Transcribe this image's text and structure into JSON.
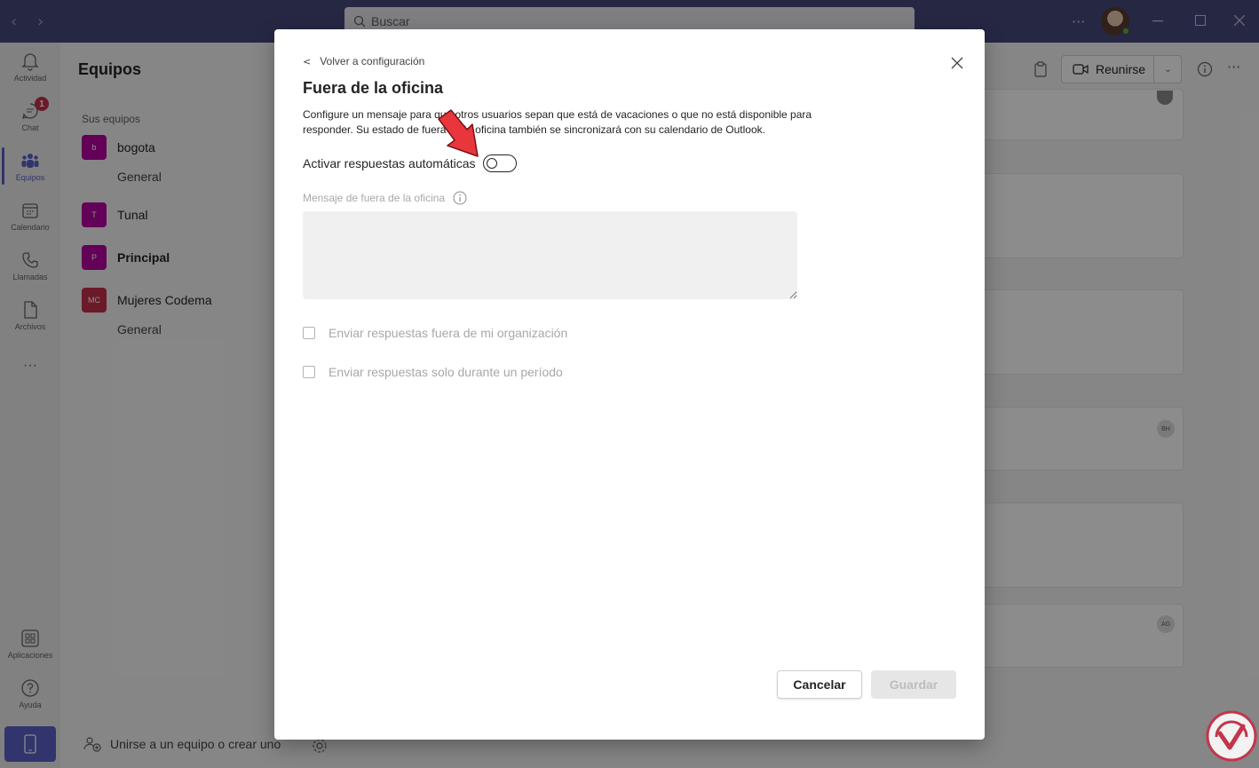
{
  "titlebar": {
    "search_placeholder": "Buscar",
    "back_icon": "chevron-left-icon",
    "forward_icon": "chevron-right-icon",
    "more_icon": "ellipsis-icon"
  },
  "rail": {
    "items": [
      {
        "label": "Actividad",
        "icon": "bell-icon"
      },
      {
        "label": "Chat",
        "icon": "chat-icon",
        "badge": "1"
      },
      {
        "label": "Equipos",
        "icon": "teams-icon",
        "active": true
      },
      {
        "label": "Calendario",
        "icon": "calendar-icon"
      },
      {
        "label": "Llamadas",
        "icon": "phone-icon"
      },
      {
        "label": "Archivos",
        "icon": "file-icon"
      },
      {
        "label": "Aplicaciones",
        "icon": "apps-icon"
      },
      {
        "label": "Ayuda",
        "icon": "help-icon"
      }
    ],
    "more_label": "···"
  },
  "panel": {
    "title": "Equipos",
    "subtitle": "Sus equipos",
    "teams": [
      {
        "name": "bogota",
        "initials": "b",
        "color": "#b4009e",
        "channel": "General"
      },
      {
        "name": "Tunal",
        "initials": "T",
        "color": "#b4009e"
      },
      {
        "name": "Principal",
        "initials": "P",
        "color": "#b4009e",
        "bold": true
      },
      {
        "name": "Mujeres Codema",
        "initials": "MC",
        "color": "#c4314b",
        "channel": "General"
      }
    ],
    "join_label": "Unirse a un equipo o crear uno"
  },
  "content": {
    "meet_label": "Reunirse",
    "avatars": [
      "BH",
      "AG"
    ]
  },
  "dialog": {
    "back_label": "Volver a configuración",
    "title": "Fuera de la oficina",
    "description": "Configure un mensaje para que otros usuarios sepan que está de vacaciones o que no está disponible para responder. Su estado de fuera de la oficina también se sincronizará con su calendario de Outlook.",
    "toggle_label": "Activar respuestas automáticas",
    "toggle_on": false,
    "message_label": "Mensaje de fuera de la oficina",
    "message_value": "",
    "check_outside_org": "Enviar respuestas fuera de mi organización",
    "check_period": "Enviar respuestas solo durante un período",
    "cancel_label": "Cancelar",
    "save_label": "Guardar"
  },
  "colors": {
    "titlebar": "#46477a",
    "accent": "#5b5fc7",
    "annotation_arrow": "#e8363c"
  }
}
